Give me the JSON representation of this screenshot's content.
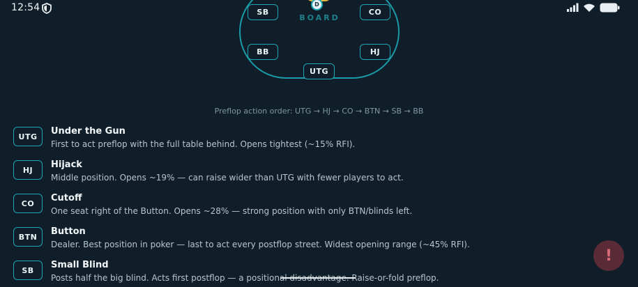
{
  "status_bar": {
    "time": "12:54",
    "icons": [
      "shield-icon",
      "signal-icon",
      "wifi-icon",
      "battery-icon"
    ]
  },
  "table": {
    "board_label": "BOARD",
    "dealer_label": "D",
    "seats": {
      "sb": "SB",
      "co": "CO",
      "bb": "BB",
      "hj": "HJ",
      "utg": "UTG"
    }
  },
  "action_order_text": "Preflop action order: UTG → HJ → CO → BTN → SB → BB",
  "positions": [
    {
      "badge": "UTG",
      "title": "Under the Gun",
      "description": "First to act preflop with the full table behind. Opens tightest (~15% RFI)."
    },
    {
      "badge": "HJ",
      "title": "Hijack",
      "description": "Middle position. Opens ~19% — can raise wider than UTG with fewer players to act."
    },
    {
      "badge": "CO",
      "title": "Cutoff",
      "description": "One seat right of the Button. Opens ~28% — strong position with only BTN/blinds left."
    },
    {
      "badge": "BTN",
      "title": "Button",
      "description": "Dealer. Best position in poker — last to act every postflop street. Widest opening range (~45% RFI)."
    },
    {
      "badge": "SB",
      "title": "Small Blind",
      "description": "Posts half the big blind. Acts first postflop — a positional disadvantage. Raise-or-fold preflop."
    }
  ],
  "feedback_button": {
    "label": "!"
  },
  "colors": {
    "background": "#0f1e28",
    "accent": "#1fa6b5",
    "dealer_chip": "#e1b73e",
    "feedback_button": "#5a2a36"
  }
}
